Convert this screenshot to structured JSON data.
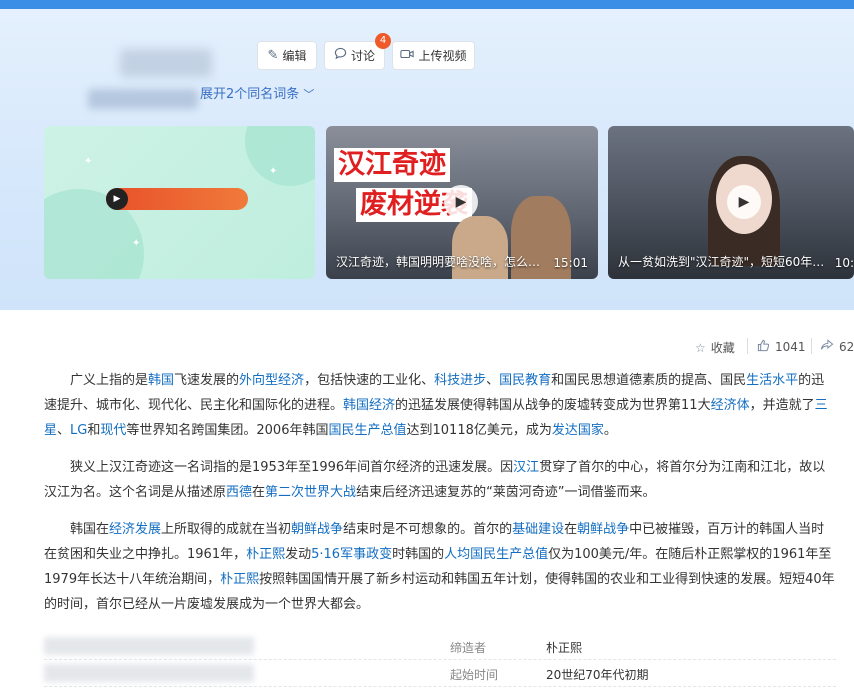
{
  "header": {
    "edit_label": "编辑",
    "discuss_label": "讨论",
    "discuss_badge": "4",
    "upload_label": "上传视频",
    "expand_label": "展开2个同名词条"
  },
  "videos": [
    {
      "caption": "",
      "duration": ""
    },
    {
      "headline1": "汉江奇迹",
      "headline2": "废材逆袭",
      "caption": "汉江奇迹，韩国明明要啥没啥，怎么…",
      "duration": "15:01"
    },
    {
      "caption": "从一贫如洗到\"汉江奇迹\"，短短60年…",
      "duration": "10:"
    }
  ],
  "actions": {
    "favorite_label": "收藏",
    "like_count": "1041",
    "share_count": "62"
  },
  "paragraphs": {
    "p1": [
      {
        "t": "广义上指的是"
      },
      {
        "l": "韩国"
      },
      {
        "t": "飞速发展的"
      },
      {
        "l": "外向型经济"
      },
      {
        "t": "，包括快速的工业化、"
      },
      {
        "l": "科技进步"
      },
      {
        "t": "、"
      },
      {
        "l": "国民教育"
      },
      {
        "t": "和国民思想道德素质的提高、国民"
      },
      {
        "l": "生活水平"
      },
      {
        "t": "的迅速提升、城市化、现代化、民主化和国际化的进程。"
      },
      {
        "l": "韩国经济"
      },
      {
        "t": "的迅猛发展使得韩国从战争的废墟转变成为世界第11大"
      },
      {
        "l": "经济体"
      },
      {
        "t": "，并造就了"
      },
      {
        "l": "三星"
      },
      {
        "t": "、"
      },
      {
        "l": "LG"
      },
      {
        "t": "和"
      },
      {
        "l": "现代"
      },
      {
        "t": "等世界知名跨国集团。2006年韩国"
      },
      {
        "l": "国民生产总值"
      },
      {
        "t": "达到10118亿美元，成为"
      },
      {
        "l": "发达国家"
      },
      {
        "t": "。"
      }
    ],
    "p2": [
      {
        "t": "狭义上汉江奇迹这一名词指的是1953年至1996年间首尔经济的迅速发展。因"
      },
      {
        "l": "汉江"
      },
      {
        "t": "贯穿了首尔的中心，将首尔分为江南和江北，故以汉江为名。这个名词是从描述原"
      },
      {
        "l": "西德"
      },
      {
        "t": "在"
      },
      {
        "l": "第二次世界大战"
      },
      {
        "t": "结束后经济迅速复苏的“莱茵河奇迹”一词借鉴而来。"
      }
    ],
    "p3": [
      {
        "t": "韩国在"
      },
      {
        "l": "经济发展"
      },
      {
        "t": "上所取得的成就在当初"
      },
      {
        "l": "朝鲜战争"
      },
      {
        "t": "结束时是不可想象的。首尔的"
      },
      {
        "l": "基础建设"
      },
      {
        "t": "在"
      },
      {
        "l": "朝鲜战争"
      },
      {
        "t": "中已被摧毁，百万计的韩国人当时在贫困和失业之中挣扎。1961年，"
      },
      {
        "l": "朴正熙"
      },
      {
        "t": "发动"
      },
      {
        "l": "5·16军事政变"
      },
      {
        "t": "时韩国的"
      },
      {
        "l": "人均国民生产总值"
      },
      {
        "t": "仅为100美元/年。在随后朴正熙掌权的1961年至1979年长达十八年统治期间，"
      },
      {
        "l": "朴正熙"
      },
      {
        "t": "按照韩国国情开展了新乡村运动和韩国五年计划，使得韩国的农业和工业得到快速的发展。短短40年的时间，首尔已经从一片废墟发展成为一个世界大都会。"
      }
    ]
  },
  "infobox": [
    {
      "key": "缔造者",
      "value": "朴正熙",
      "is_link": true
    },
    {
      "key": "起始时间",
      "value": "20世纪70年代初期",
      "is_link": false
    }
  ]
}
